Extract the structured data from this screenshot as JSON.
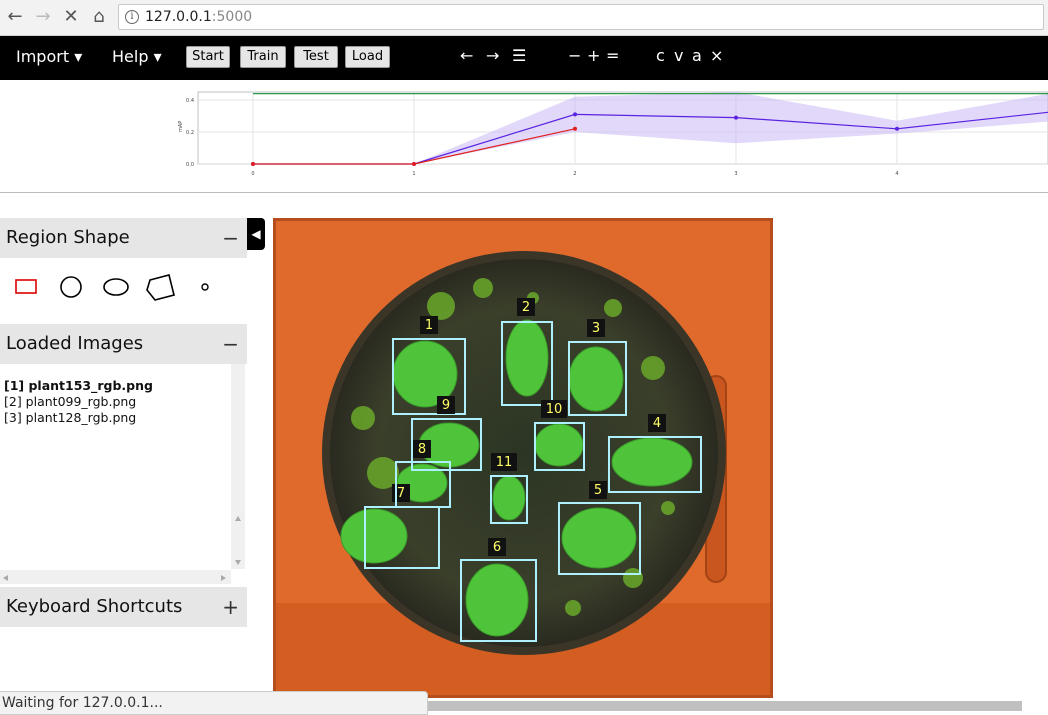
{
  "browser": {
    "url_host": "127.0.0.1",
    "url_port": ":5000",
    "status_text": "Waiting for 127.0.0.1..."
  },
  "topbar": {
    "menus": [
      "Import ▾",
      "Help ▾"
    ],
    "buttons": [
      "Start",
      "Train",
      "Test",
      "Load"
    ],
    "nav_glyphs": [
      "←",
      "→",
      "☰"
    ],
    "zoom_glyphs": [
      "−",
      "+",
      "="
    ],
    "edit_glyphs": [
      "c",
      "v",
      "a",
      "×"
    ]
  },
  "chart_data": {
    "type": "line",
    "x": [
      0,
      1,
      2,
      3,
      4,
      5
    ],
    "ylim": [
      0,
      0.45
    ],
    "xticks": [
      "0",
      "1",
      "2",
      "3",
      "4"
    ],
    "yticks": [
      "0.0",
      "0.2",
      "0.4"
    ],
    "ylabel": "mAP",
    "series": [
      {
        "color": "#5a23e0",
        "values": [
          0.0,
          0.0,
          0.31,
          0.29,
          0.22,
          0.33
        ]
      },
      {
        "color": "#e02020",
        "values": [
          0.0,
          0.0,
          0.22
        ]
      },
      {
        "color": "#2a9a4a",
        "values": [
          0.44,
          0.44,
          0.44,
          0.44,
          0.44,
          0.44
        ]
      }
    ],
    "band": {
      "upper": [
        0.0,
        0.0,
        0.42,
        0.45,
        0.27,
        0.45
      ],
      "lower": [
        0.0,
        0.0,
        0.2,
        0.13,
        0.19,
        0.27
      ],
      "color": "#c9b8f5"
    }
  },
  "sidebar": {
    "region_shape_title": "Region Shape",
    "loaded_images_title": "Loaded Images",
    "keyboard_title": "Keyboard Shortcuts",
    "collapse_symbol": "−",
    "expand_symbol": "+",
    "shapes": [
      "rectangle-icon",
      "circle-icon",
      "ellipse-icon",
      "polygon-icon",
      "point-icon"
    ],
    "files": [
      "[1] plant153_rgb.png",
      "[2] plant099_rgb.png",
      "[3] plant128_rgb.png"
    ]
  },
  "regions": [
    "1",
    "2",
    "3",
    "4",
    "5",
    "6",
    "7",
    "8",
    "9",
    "10",
    "11"
  ]
}
